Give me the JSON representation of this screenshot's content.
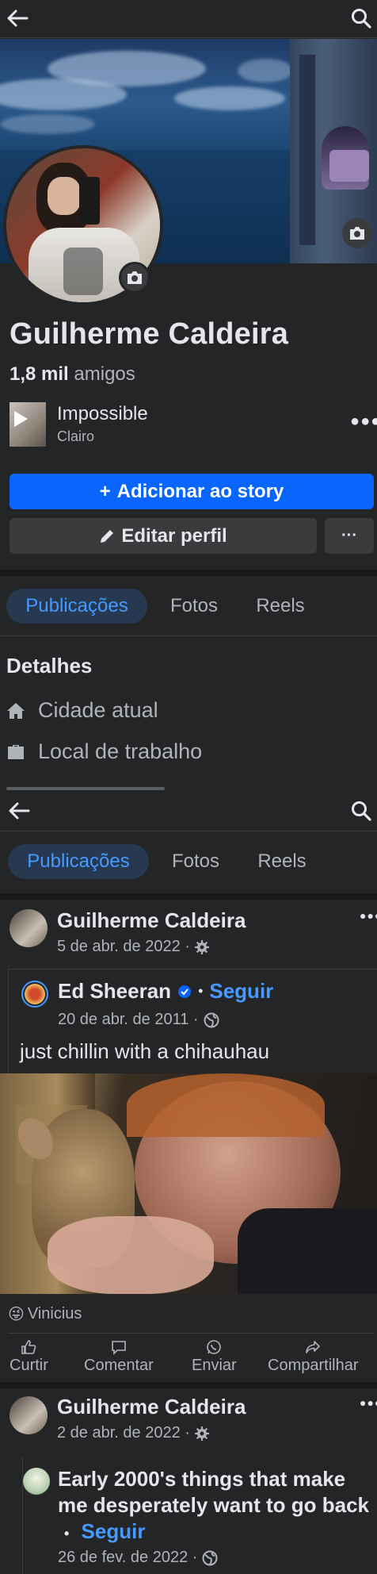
{
  "profile": {
    "name": "Guilherme Caldeira",
    "friends_count": "1,8 mil",
    "friends_label": "amigos",
    "music": {
      "song": "Impossible",
      "artist": "Clairo"
    },
    "add_story_label": "Adicionar ao story",
    "edit_profile_label": "Editar perfil",
    "more_label": "···"
  },
  "tabs": [
    {
      "label": "Publicações",
      "active": true
    },
    {
      "label": "Fotos",
      "active": false
    },
    {
      "label": "Reels",
      "active": false
    }
  ],
  "details": {
    "title": "Detalhes",
    "items": [
      {
        "label": "Cidade atual",
        "icon": "home-icon"
      },
      {
        "label": "Local de trabalho",
        "icon": "briefcase-icon"
      }
    ]
  },
  "posts": [
    {
      "author": "Guilherme Caldeira",
      "date": "5 de abr. de 2022 ·",
      "privacy_icon": "gear-icon",
      "shared": {
        "author": "Ed Sheeran",
        "verified": true,
        "follow_label": "Seguir",
        "date": "20 de abr. de 2011 ·",
        "privacy_icon": "globe-icon",
        "text": "just chillin with a chihauhau"
      },
      "reactions": {
        "emoji": "😜",
        "names": "Vinicius"
      },
      "actions": [
        "Curtir",
        "Comentar",
        "Enviar",
        "Compartilhar"
      ]
    },
    {
      "author": "Guilherme Caldeira",
      "date": "2 de abr. de 2022 ·",
      "privacy_icon": "gear-icon",
      "shared": {
        "title": "Early 2000's things that make me desperately want to go back",
        "follow_label": "Seguir",
        "date": "26 de fev. de 2022 ·",
        "privacy_icon": "globe-icon"
      }
    }
  ],
  "dot_separator": "•",
  "colors": {
    "background": "#242526",
    "accent": "#0866ff",
    "link": "#4599ff",
    "text": "#e4e6eb",
    "muted": "#b0b3b8"
  }
}
